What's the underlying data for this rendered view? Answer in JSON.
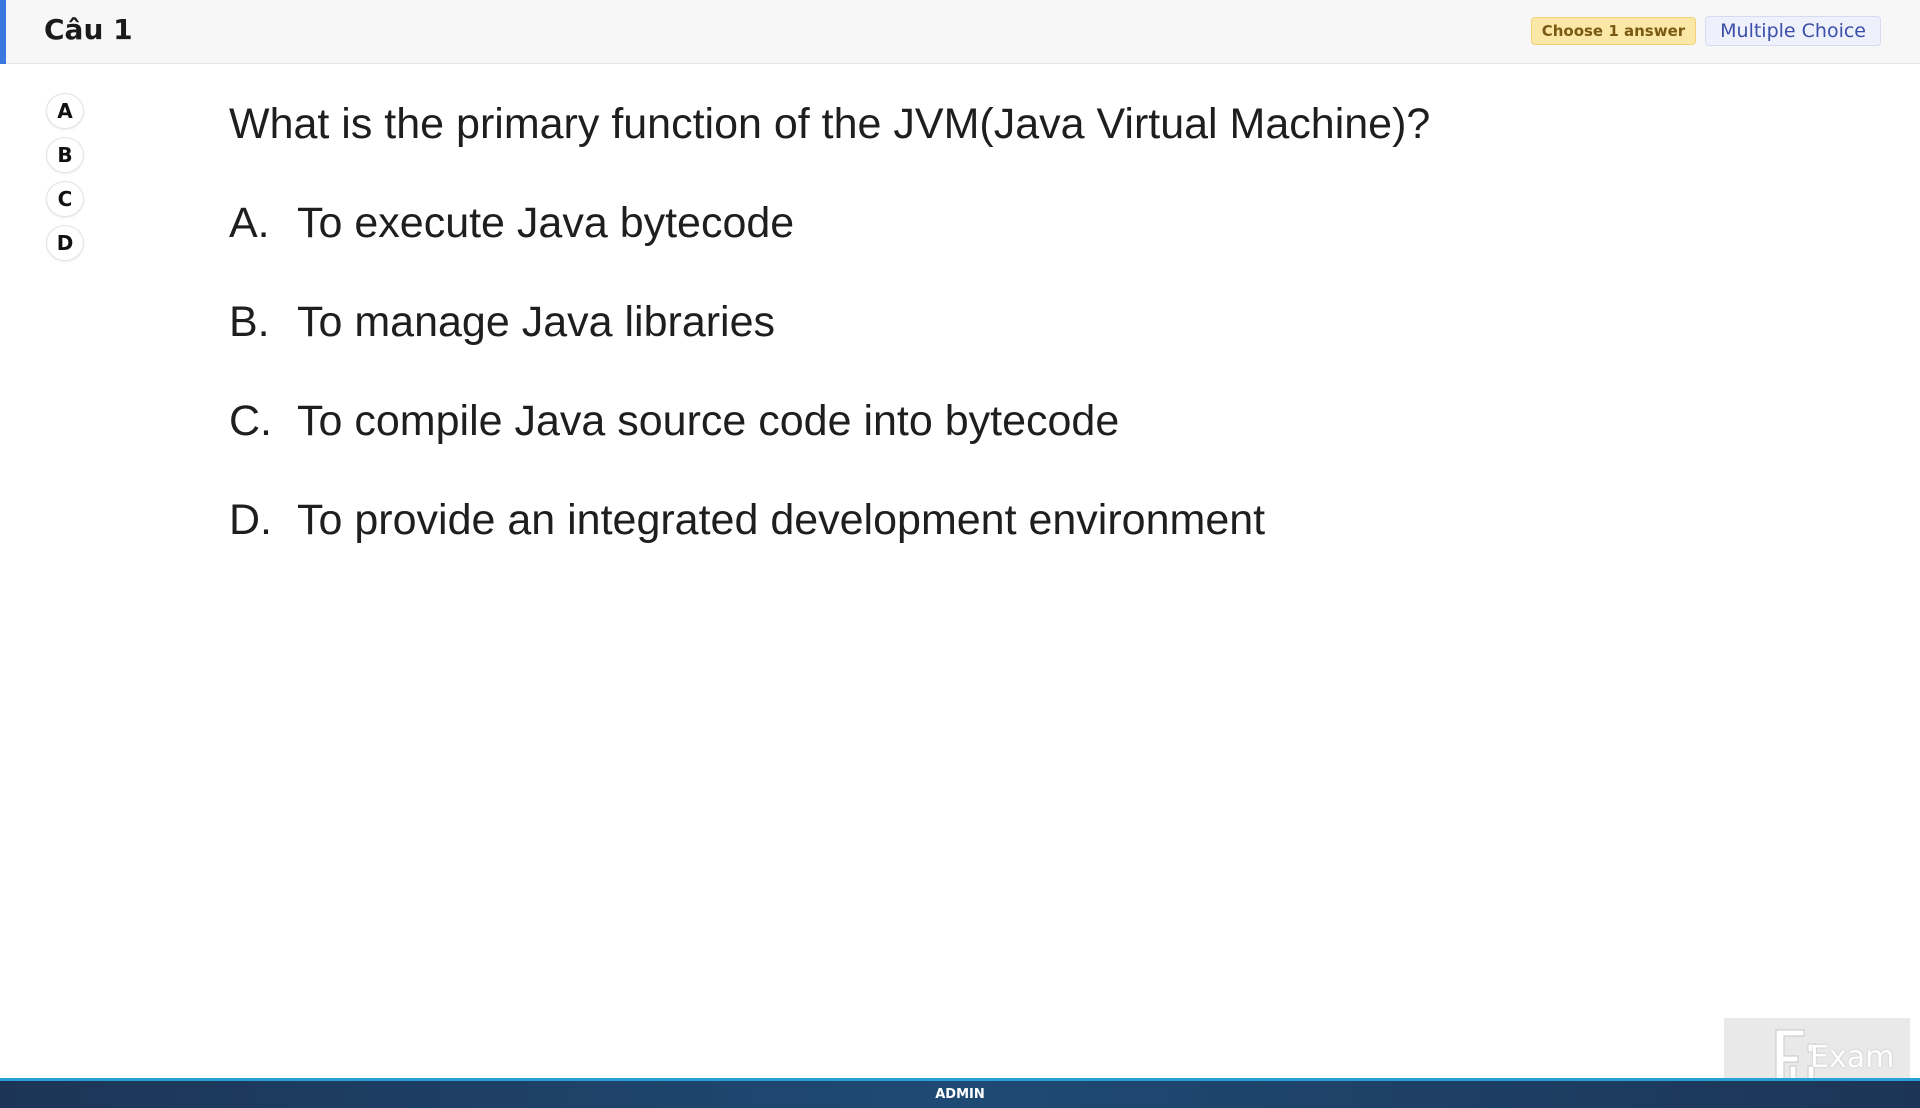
{
  "header": {
    "question_label": "Câu 1",
    "choose_badge": "Choose 1 answer",
    "type_badge": "Multiple Choice"
  },
  "answer_buttons": [
    "A",
    "B",
    "C",
    "D"
  ],
  "question": {
    "text": "What is the primary function of the JVM(Java Virtual Machine)?",
    "options": [
      {
        "letter": "A.",
        "text": "To execute Java bytecode"
      },
      {
        "letter": "B.",
        "text": "To manage Java libraries"
      },
      {
        "letter": "C.",
        "text": "To compile Java source code into bytecode"
      },
      {
        "letter": "D.",
        "text": "To provide an integrated development environment"
      }
    ]
  },
  "footer": {
    "user_label": "ADMIN"
  },
  "logo": {
    "text": "Exam",
    "icon": "fu-exam-logo-icon"
  },
  "colors": {
    "accent": "#3a78e0",
    "choose_badge_bg": "#fbe7a6",
    "type_badge_bg": "#eef0fb",
    "footer_bg": "#1f4a74"
  }
}
